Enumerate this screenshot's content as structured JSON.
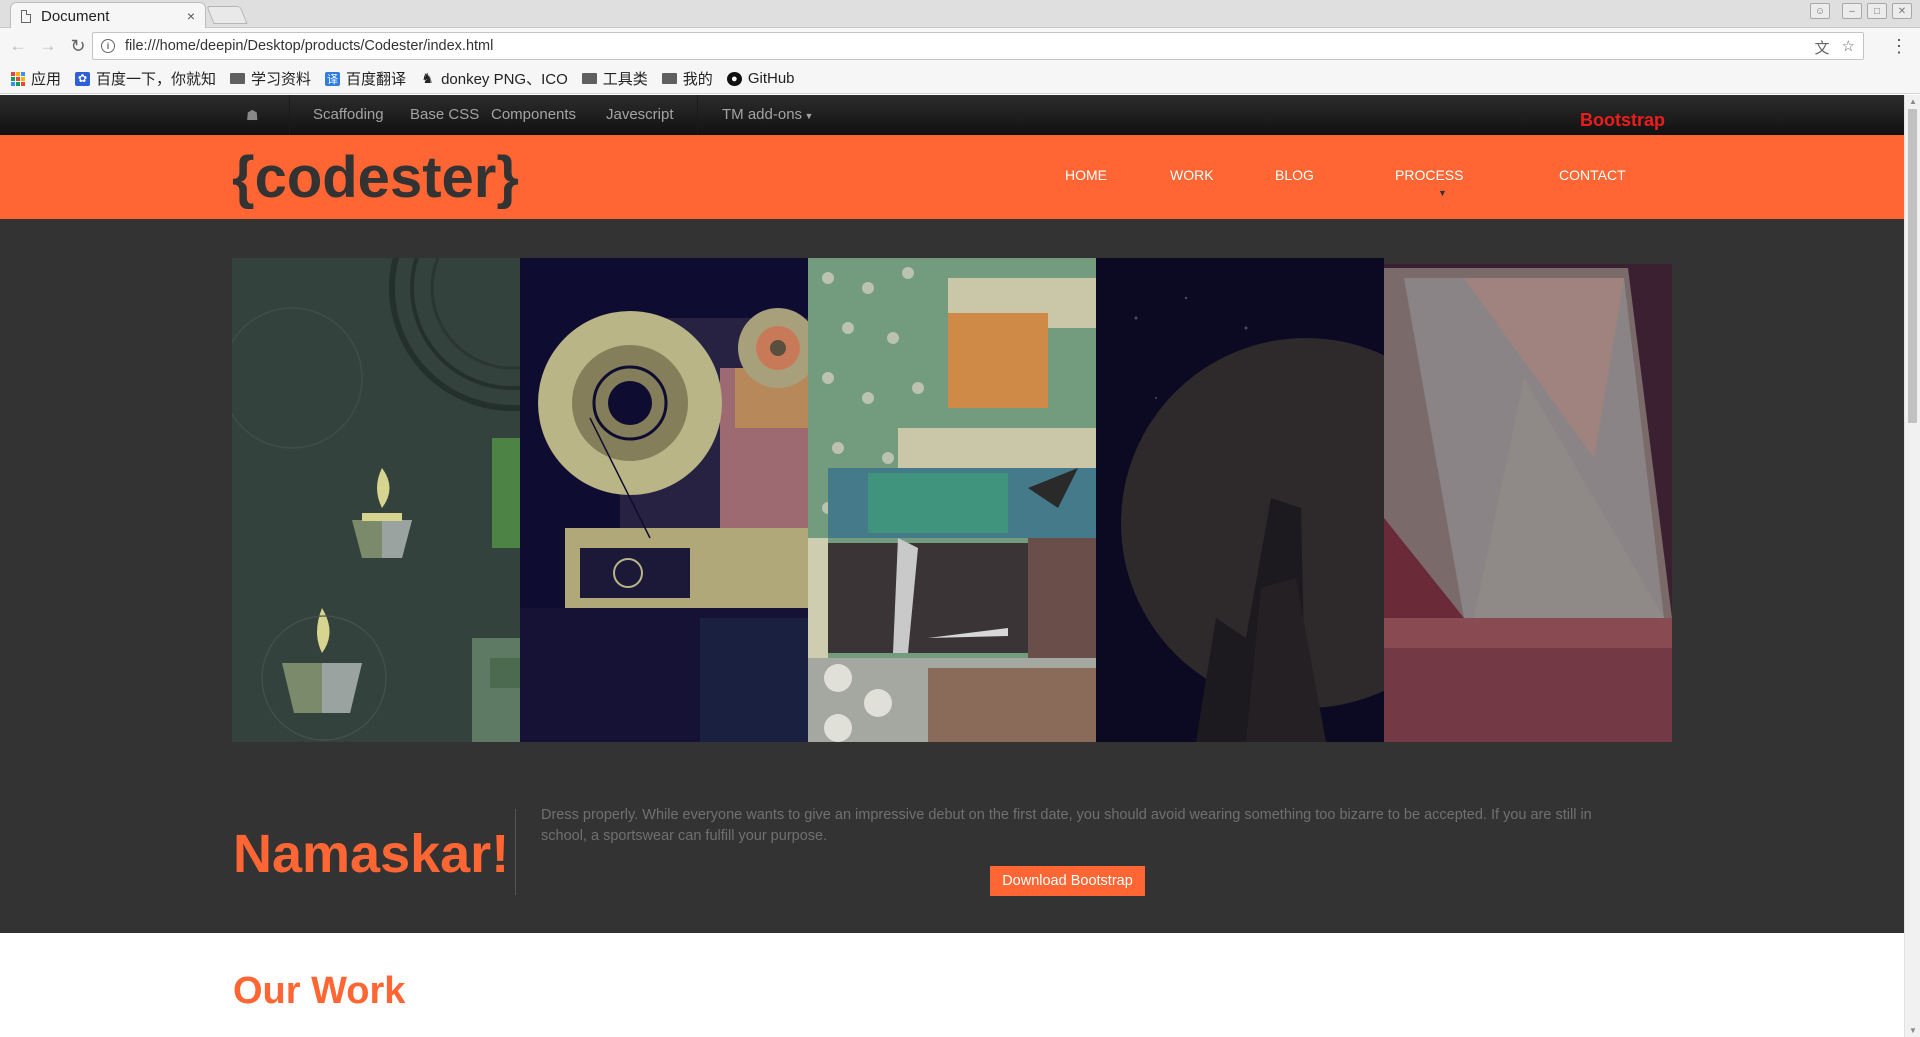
{
  "browser": {
    "tab_title": "Document",
    "tab_close": "×",
    "url": "file:///home/deepin/Desktop/products/Codester/index.html",
    "bookmarks": [
      {
        "label": "应用",
        "icon": "apps-icon"
      },
      {
        "label": "百度一下，你就知",
        "icon": "baidu-icon"
      },
      {
        "label": "学习资料",
        "icon": "folder-icon"
      },
      {
        "label": "百度翻译",
        "icon": "fanyi-icon"
      },
      {
        "label": "donkey PNG、ICO",
        "icon": "donkey-icon"
      },
      {
        "label": "工具类",
        "icon": "folder-icon"
      },
      {
        "label": "我的",
        "icon": "folder-icon"
      },
      {
        "label": "GitHub",
        "icon": "github-icon"
      }
    ]
  },
  "bootstrap_nav": {
    "items": [
      "Scaffoding",
      "Base CSS",
      "Components",
      "Javescript",
      "TM add-ons"
    ],
    "brand": "Bootstrap"
  },
  "header": {
    "logo": "{codester}",
    "nav": [
      "HOME",
      "WORK",
      "BLOG",
      "PROCESS",
      "CONTACT"
    ]
  },
  "hero": {
    "panels": [
      "candles-illustration",
      "film-projector-illustration",
      "collage-illustration",
      "night-moon-illustration",
      "abstract-frame-illustration"
    ],
    "greeting": "Namaskar!",
    "text": "Dress properly. While everyone wants to give an impressive debut on the first date, you should avoid wearing something too bizarre to be accepted. If you are still in school, a sportswear can fulfill your purpose.",
    "button": "Download Bootstrap"
  },
  "work": {
    "title": "Our Work"
  },
  "colors": {
    "accent": "#ff6633",
    "dark": "#333333",
    "brand_red": "#ee1c1c"
  }
}
